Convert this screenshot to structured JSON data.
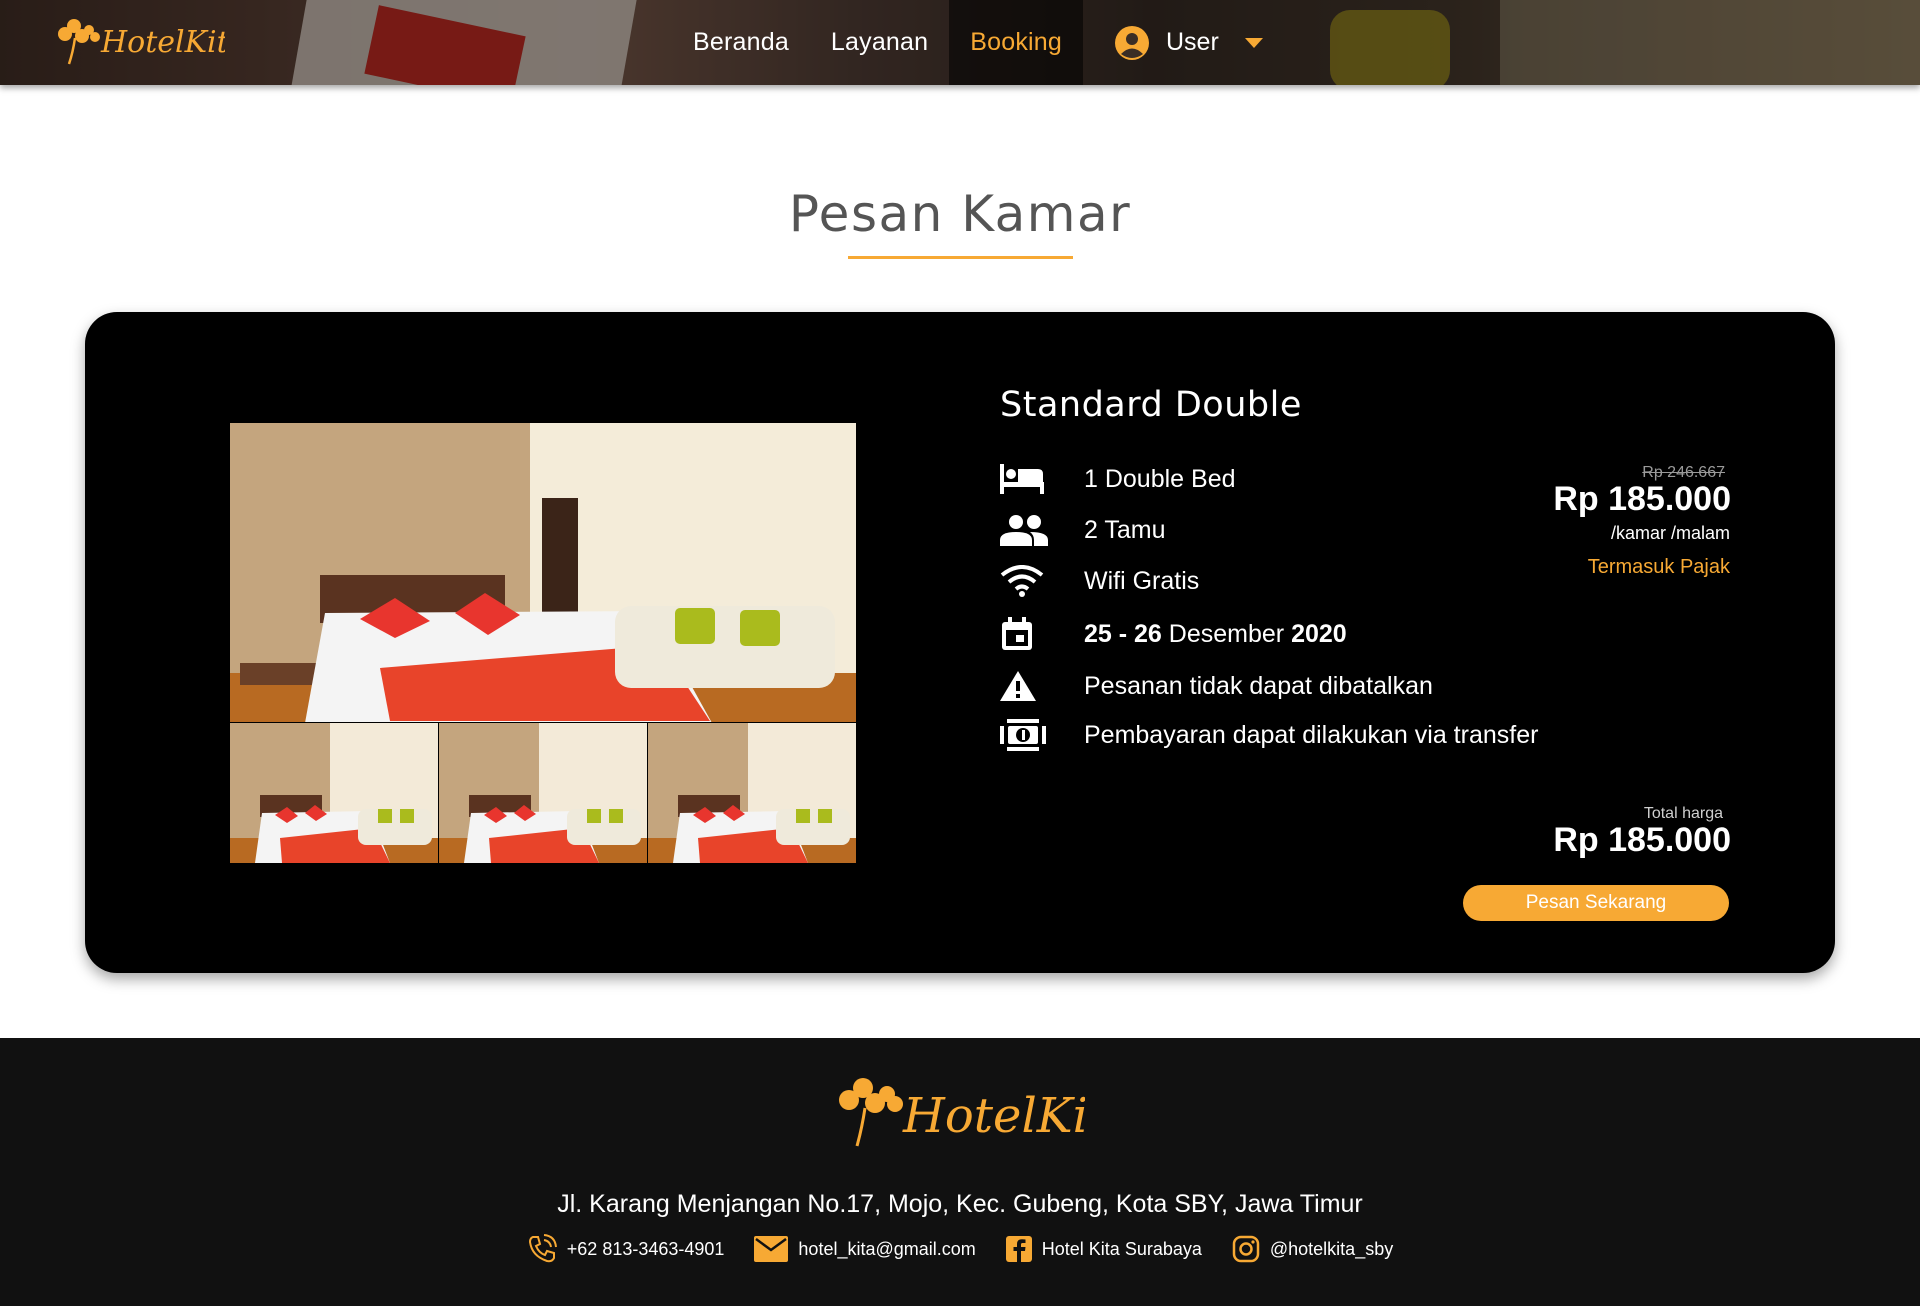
{
  "brand": {
    "name": "HotelKita"
  },
  "nav": {
    "links": [
      {
        "label": "Beranda",
        "active": false
      },
      {
        "label": "Layanan",
        "active": false
      },
      {
        "label": "Booking",
        "active": true
      }
    ],
    "user_label": "User"
  },
  "page": {
    "title": "Pesan Kamar"
  },
  "room": {
    "name": "Standard Double",
    "features": [
      {
        "icon": "bed-icon",
        "text": "1 Double Bed"
      },
      {
        "icon": "people-icon",
        "text": "2 Tamu"
      },
      {
        "icon": "wifi-icon",
        "text": "Wifi Gratis"
      },
      {
        "icon": "calendar-icon",
        "date_start": "25",
        "date_sep": " - ",
        "date_end": "26",
        "month": " Desember ",
        "year": "2020"
      },
      {
        "icon": "warning-icon",
        "text": "Pesanan tidak dapat dibatalkan"
      },
      {
        "icon": "money-icon",
        "text": "Pembayaran dapat dilakukan via transfer"
      }
    ],
    "price_original": "Rp 246.667",
    "price_current": "Rp 185.000",
    "price_unit": "/kamar /malam",
    "tax_note": "Termasuk Pajak",
    "total_label": "Total harga",
    "total_price": "Rp 185.000",
    "book_button": "Pesan Sekarang"
  },
  "footer": {
    "address": "Jl. Karang Menjangan No.17, Mojo, Kec. Gubeng, Kota SBY, Jawa Timur",
    "phone": "+62 813-3463-4901",
    "email": "hotel_kita@gmail.com",
    "facebook": "Hotel Kita Surabaya",
    "instagram": "@hotelkita_sby"
  },
  "colors": {
    "accent": "#f7a934",
    "card_bg": "#000000",
    "footer_bg": "#111111"
  }
}
